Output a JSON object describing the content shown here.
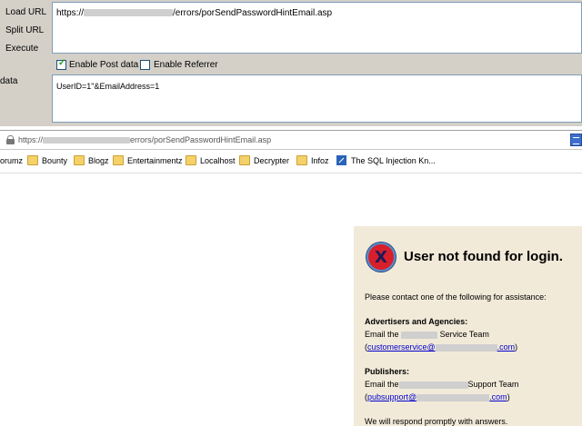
{
  "hackbar": {
    "load_url": "Load URL",
    "split_url": "Split URL",
    "execute": "Execute",
    "data_label": "data",
    "url_prefix": "https://",
    "url_suffix": "/errors/porSendPasswordHintEmail.asp",
    "enable_post": "Enable Post data",
    "enable_referrer": "Enable Referrer",
    "post_data": "UserID=1\"&EmailAddress=1"
  },
  "addressbar": {
    "prefix": "https://",
    "suffix": "errors/porSendPasswordHintEmail.asp"
  },
  "bookmarks": [
    {
      "label": "orumz",
      "icon": "none"
    },
    {
      "label": "Bounty",
      "icon": "folder-icon"
    },
    {
      "label": "Blogz",
      "icon": "folder-icon"
    },
    {
      "label": "Entertainmentz",
      "icon": "folder-icon"
    },
    {
      "label": "Localhost",
      "icon": "folder-icon"
    },
    {
      "label": "Decrypter",
      "icon": "folder-icon"
    },
    {
      "label": "Infoz",
      "icon": "folder-icon"
    },
    {
      "label": "The SQL Injection Kn...",
      "icon": "sql-icon"
    }
  ],
  "message": {
    "title": "User not found for login.",
    "intro": "Please contact one of the following for assistance:",
    "advertisers_heading": "Advertisers and Agencies:",
    "adv_email_pre": "Email the",
    "adv_email_post": "Service Team",
    "adv_open": "(",
    "adv_link_pre": "customerservice@",
    "adv_link_post": ".com",
    "adv_close": ")",
    "publishers_heading": "Publishers:",
    "pub_email_pre": "Email the",
    "pub_email_post": "Support Team",
    "pub_open": "(",
    "pub_link_pre": "pubsupport@",
    "pub_link_post": ".com",
    "pub_close": ")",
    "respond": "We will respond promptly with answers."
  }
}
